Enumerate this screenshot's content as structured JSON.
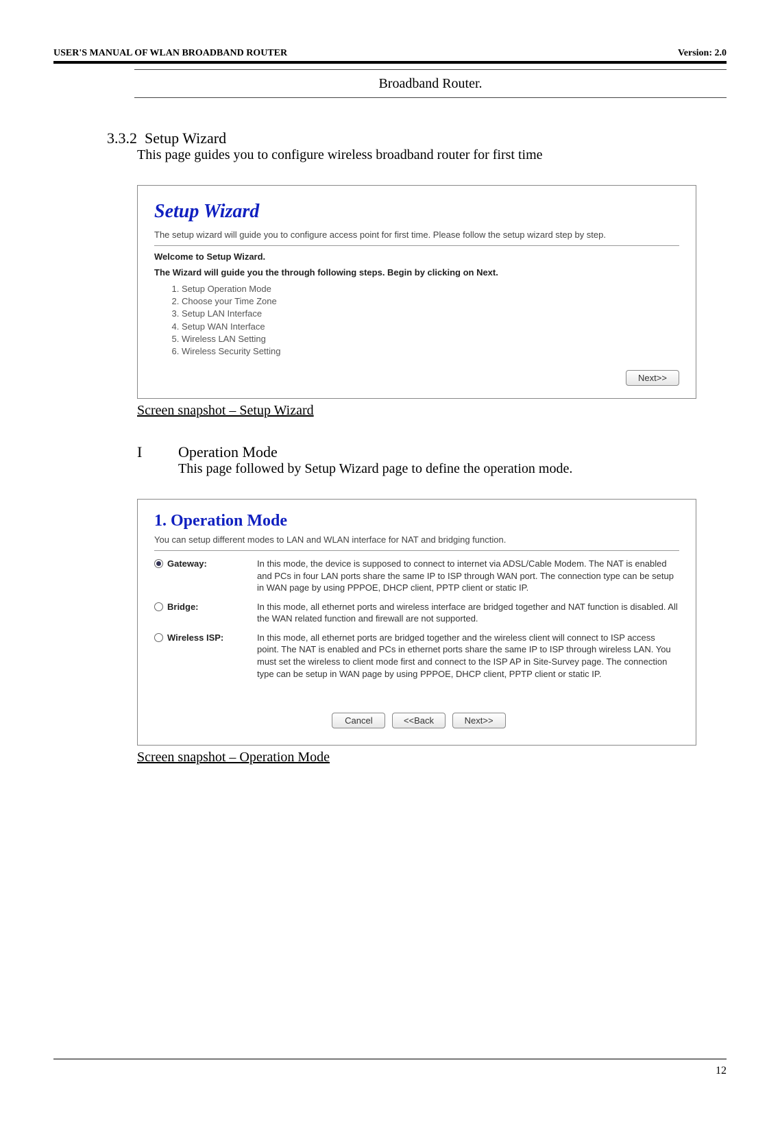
{
  "header": {
    "left": "USER'S MANUAL OF WLAN BROADBAND ROUTER",
    "right": "Version: 2.0"
  },
  "prev_table_cell": "Broadband Router.",
  "section": {
    "number": "3.3.2",
    "title": "Setup Wizard",
    "intro": "This page guides you to configure wireless broadband router for first time"
  },
  "setup_wizard_shot": {
    "title": "Setup Wizard",
    "sub": "The setup wizard will guide you to configure access point for first time. Please follow the setup wizard step by step.",
    "welcome": "Welcome to Setup Wizard.",
    "instruction": "The Wizard will guide you the through following steps. Begin by clicking on Next.",
    "steps": [
      "Setup Operation Mode",
      "Choose your Time Zone",
      "Setup LAN Interface",
      "Setup WAN Interface",
      "Wireless LAN Setting",
      "Wireless Security Setting"
    ],
    "next_btn": "Next>>"
  },
  "caption1": "Screen snapshot – Setup Wizard",
  "subsection": {
    "index": "I",
    "title": "Operation Mode",
    "intro": "This page followed by Setup Wizard page to define the operation mode."
  },
  "operation_mode_shot": {
    "title": "1. Operation Mode",
    "sub": "You can setup different modes to LAN and WLAN interface for NAT and bridging function.",
    "modes": [
      {
        "label": "Gateway:",
        "checked": true,
        "desc": "In this mode, the device is supposed to connect to internet via ADSL/Cable Modem. The NAT is enabled and PCs in four LAN ports share the same IP to ISP through WAN port. The connection type can be setup in WAN page by using PPPOE, DHCP client, PPTP client or static IP."
      },
      {
        "label": "Bridge:",
        "checked": false,
        "desc": "In this mode, all ethernet ports and wireless interface are bridged together and NAT function is disabled. All the WAN related function and firewall are not supported."
      },
      {
        "label": "Wireless ISP:",
        "checked": false,
        "desc": "In this mode, all ethernet ports are bridged together and the wireless client will connect to ISP access point. The NAT is enabled and PCs in ethernet ports share the same IP to ISP through wireless LAN. You must set the wireless to client mode first and connect to the ISP AP in Site-Survey page. The connection type can be setup in WAN page by using PPPOE, DHCP client, PPTP client or static IP."
      }
    ],
    "cancel_btn": "Cancel",
    "back_btn": "<<Back",
    "next_btn": "Next>>"
  },
  "caption2": "Screen snapshot – Operation Mode",
  "page_number": "12"
}
